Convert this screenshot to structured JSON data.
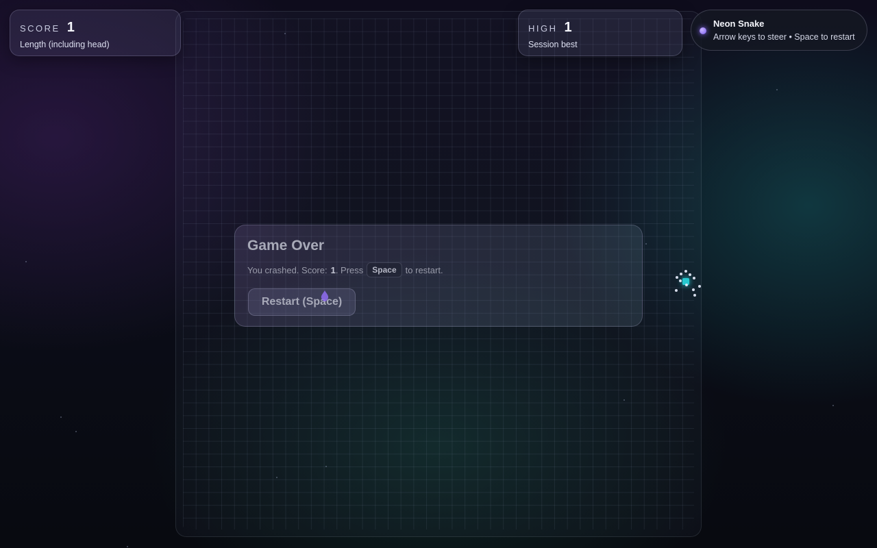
{
  "score_card": {
    "label": "SCORE",
    "value": "1",
    "subtitle": "Length (including head)"
  },
  "high_card": {
    "label": "HIGH",
    "value": "1",
    "subtitle": "Session best"
  },
  "title_pill": {
    "name": "Neon Snake",
    "hint": "Arrow keys to steer • Space to restart",
    "dot_color": "#8d6cff"
  },
  "game_over": {
    "title": "Game Over",
    "message_prefix": "You crashed. Score:",
    "score": "1",
    "message_mid": ". Press",
    "key": "Space",
    "message_suffix": "to restart.",
    "restart_label": "Restart (Space)"
  },
  "colors": {
    "snake_head": "#27c8d0",
    "accent": "#8d6cff"
  }
}
